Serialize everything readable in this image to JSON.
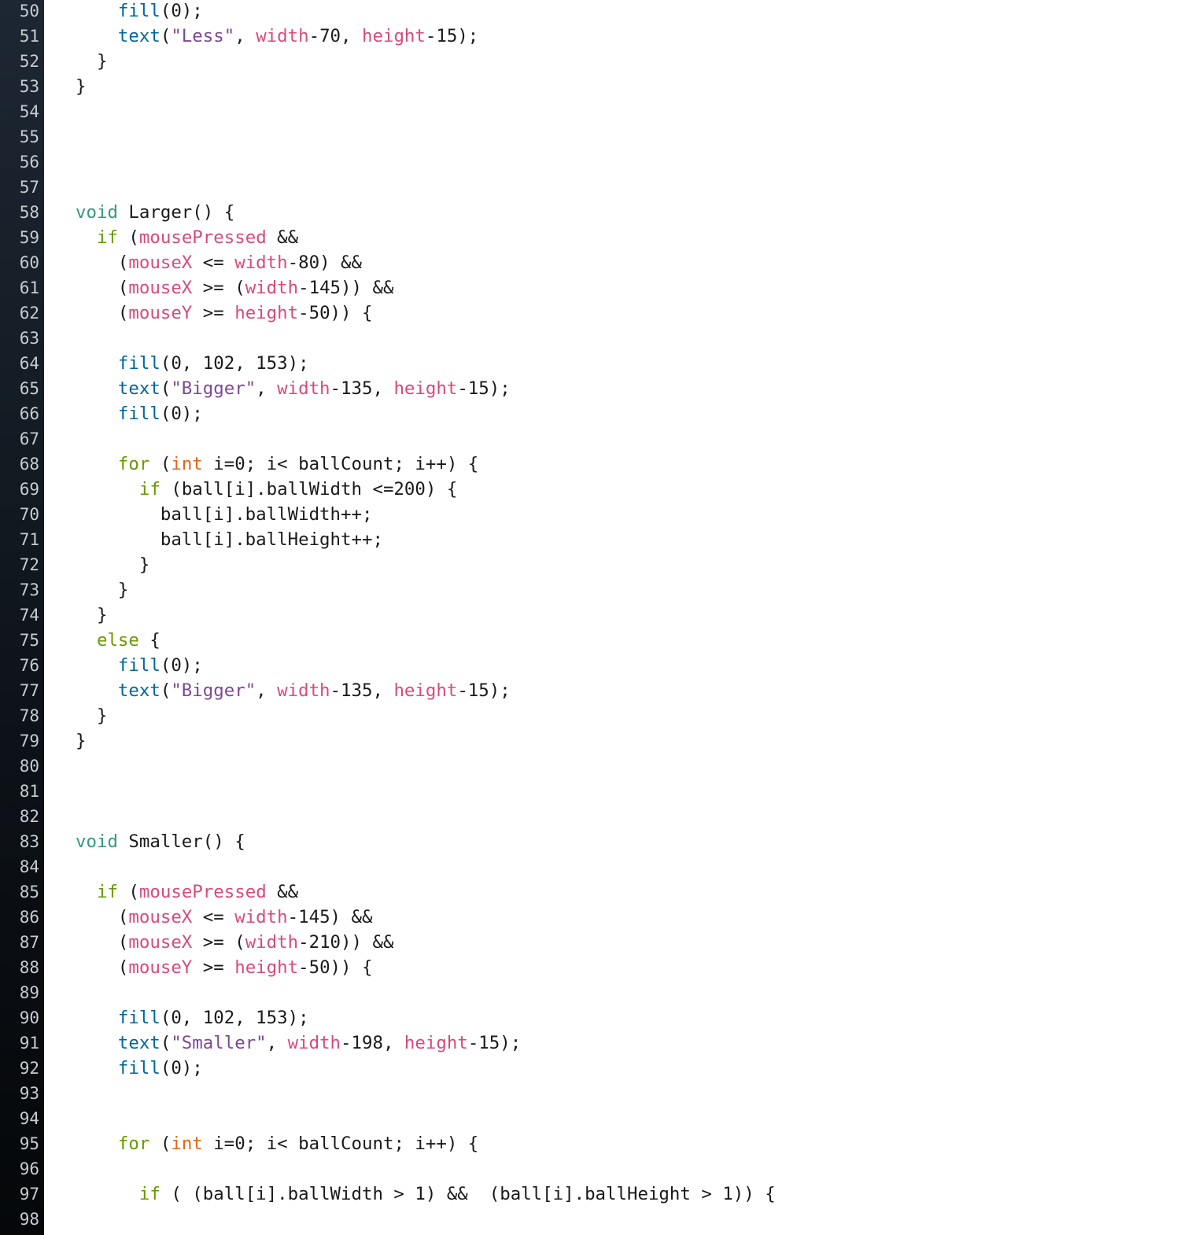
{
  "editor": {
    "language": "Processing",
    "colors": {
      "gutter_top": "#1d2733",
      "gutter_bottom": "#050709",
      "line_number": "#c7ccd2",
      "keyword_void": "#33997e",
      "keyword_control": "#669900",
      "function": "#006699",
      "builtin_variable": "#d94a7a",
      "string": "#7d4793",
      "type": "#e2661a",
      "plain": "#1a1a1a"
    },
    "lines": [
      {
        "n": "50",
        "tokens": [
          [
            "",
            "    "
          ],
          [
            "f",
            "fill"
          ],
          [
            "",
            "(0);"
          ]
        ]
      },
      {
        "n": "51",
        "tokens": [
          [
            "",
            "    "
          ],
          [
            "f",
            "text"
          ],
          [
            "",
            "("
          ],
          [
            "s",
            "\"Less\""
          ],
          [
            "",
            ", "
          ],
          [
            "v",
            "width"
          ],
          [
            "",
            "-70, "
          ],
          [
            "v",
            "height"
          ],
          [
            "",
            "-15);"
          ]
        ]
      },
      {
        "n": "52",
        "tokens": [
          [
            "",
            "  }"
          ]
        ]
      },
      {
        "n": "53",
        "tokens": [
          [
            "",
            "}"
          ]
        ]
      },
      {
        "n": "54",
        "tokens": []
      },
      {
        "n": "55",
        "tokens": []
      },
      {
        "n": "56",
        "tokens": []
      },
      {
        "n": "57",
        "tokens": []
      },
      {
        "n": "58",
        "tokens": [
          [
            "k",
            "void"
          ],
          [
            "",
            " Larger() {"
          ]
        ]
      },
      {
        "n": "59",
        "tokens": [
          [
            "",
            "  "
          ],
          [
            "kw",
            "if"
          ],
          [
            "",
            " ("
          ],
          [
            "v",
            "mousePressed"
          ],
          [
            "",
            " &&"
          ]
        ]
      },
      {
        "n": "60",
        "tokens": [
          [
            "",
            "    ("
          ],
          [
            "v",
            "mouseX"
          ],
          [
            "",
            " <= "
          ],
          [
            "v",
            "width"
          ],
          [
            "",
            "-80) &&"
          ]
        ]
      },
      {
        "n": "61",
        "tokens": [
          [
            "",
            "    ("
          ],
          [
            "v",
            "mouseX"
          ],
          [
            "",
            " >= ("
          ],
          [
            "v",
            "width"
          ],
          [
            "",
            "-145)) &&"
          ]
        ]
      },
      {
        "n": "62",
        "tokens": [
          [
            "",
            "    ("
          ],
          [
            "v",
            "mouseY"
          ],
          [
            "",
            " >= "
          ],
          [
            "v",
            "height"
          ],
          [
            "",
            "-50)) {"
          ]
        ]
      },
      {
        "n": "63",
        "tokens": []
      },
      {
        "n": "64",
        "tokens": [
          [
            "",
            "    "
          ],
          [
            "f",
            "fill"
          ],
          [
            "",
            "(0, 102, 153);"
          ]
        ]
      },
      {
        "n": "65",
        "tokens": [
          [
            "",
            "    "
          ],
          [
            "f",
            "text"
          ],
          [
            "",
            "("
          ],
          [
            "s",
            "\"Bigger\""
          ],
          [
            "",
            ", "
          ],
          [
            "v",
            "width"
          ],
          [
            "",
            "-135, "
          ],
          [
            "v",
            "height"
          ],
          [
            "",
            "-15);"
          ]
        ]
      },
      {
        "n": "66",
        "tokens": [
          [
            "",
            "    "
          ],
          [
            "f",
            "fill"
          ],
          [
            "",
            "(0);"
          ]
        ]
      },
      {
        "n": "67",
        "tokens": []
      },
      {
        "n": "68",
        "tokens": [
          [
            "",
            "    "
          ],
          [
            "kw",
            "for"
          ],
          [
            "",
            " ("
          ],
          [
            "t",
            "int"
          ],
          [
            "",
            " i=0; i< ballCount; i++) {"
          ]
        ]
      },
      {
        "n": "69",
        "tokens": [
          [
            "",
            "      "
          ],
          [
            "kw",
            "if"
          ],
          [
            "",
            " (ball[i].ballWidth <=200) {"
          ]
        ]
      },
      {
        "n": "70",
        "tokens": [
          [
            "",
            "        ball[i].ballWidth++;"
          ]
        ]
      },
      {
        "n": "71",
        "tokens": [
          [
            "",
            "        ball[i].ballHeight++;"
          ]
        ]
      },
      {
        "n": "72",
        "tokens": [
          [
            "",
            "      }"
          ]
        ]
      },
      {
        "n": "73",
        "tokens": [
          [
            "",
            "    }"
          ]
        ]
      },
      {
        "n": "74",
        "tokens": [
          [
            "",
            "  }"
          ]
        ]
      },
      {
        "n": "75",
        "tokens": [
          [
            "",
            "  "
          ],
          [
            "kw",
            "else"
          ],
          [
            "",
            " {"
          ]
        ]
      },
      {
        "n": "76",
        "tokens": [
          [
            "",
            "    "
          ],
          [
            "f",
            "fill"
          ],
          [
            "",
            "(0);"
          ]
        ]
      },
      {
        "n": "77",
        "tokens": [
          [
            "",
            "    "
          ],
          [
            "f",
            "text"
          ],
          [
            "",
            "("
          ],
          [
            "s",
            "\"Bigger\""
          ],
          [
            "",
            ", "
          ],
          [
            "v",
            "width"
          ],
          [
            "",
            "-135, "
          ],
          [
            "v",
            "height"
          ],
          [
            "",
            "-15);"
          ]
        ]
      },
      {
        "n": "78",
        "tokens": [
          [
            "",
            "  }"
          ]
        ]
      },
      {
        "n": "79",
        "tokens": [
          [
            "",
            "}"
          ]
        ]
      },
      {
        "n": "80",
        "tokens": []
      },
      {
        "n": "81",
        "tokens": []
      },
      {
        "n": "82",
        "tokens": []
      },
      {
        "n": "83",
        "tokens": [
          [
            "k",
            "void"
          ],
          [
            "",
            " Smaller() {"
          ]
        ]
      },
      {
        "n": "84",
        "tokens": []
      },
      {
        "n": "85",
        "tokens": [
          [
            "",
            "  "
          ],
          [
            "kw",
            "if"
          ],
          [
            "",
            " ("
          ],
          [
            "v",
            "mousePressed"
          ],
          [
            "",
            " &&"
          ]
        ]
      },
      {
        "n": "86",
        "tokens": [
          [
            "",
            "    ("
          ],
          [
            "v",
            "mouseX"
          ],
          [
            "",
            " <= "
          ],
          [
            "v",
            "width"
          ],
          [
            "",
            "-145) &&"
          ]
        ]
      },
      {
        "n": "87",
        "tokens": [
          [
            "",
            "    ("
          ],
          [
            "v",
            "mouseX"
          ],
          [
            "",
            " >= ("
          ],
          [
            "v",
            "width"
          ],
          [
            "",
            "-210)) &&"
          ]
        ]
      },
      {
        "n": "88",
        "tokens": [
          [
            "",
            "    ("
          ],
          [
            "v",
            "mouseY"
          ],
          [
            "",
            " >= "
          ],
          [
            "v",
            "height"
          ],
          [
            "",
            "-50)) {"
          ]
        ]
      },
      {
        "n": "89",
        "tokens": []
      },
      {
        "n": "90",
        "tokens": [
          [
            "",
            "    "
          ],
          [
            "f",
            "fill"
          ],
          [
            "",
            "(0, 102, 153);"
          ]
        ]
      },
      {
        "n": "91",
        "tokens": [
          [
            "",
            "    "
          ],
          [
            "f",
            "text"
          ],
          [
            "",
            "("
          ],
          [
            "s",
            "\"Smaller\""
          ],
          [
            "",
            ", "
          ],
          [
            "v",
            "width"
          ],
          [
            "",
            "-198, "
          ],
          [
            "v",
            "height"
          ],
          [
            "",
            "-15);"
          ]
        ]
      },
      {
        "n": "92",
        "tokens": [
          [
            "",
            "    "
          ],
          [
            "f",
            "fill"
          ],
          [
            "",
            "(0);"
          ]
        ]
      },
      {
        "n": "93",
        "tokens": []
      },
      {
        "n": "94",
        "tokens": []
      },
      {
        "n": "95",
        "tokens": [
          [
            "",
            "    "
          ],
          [
            "kw",
            "for"
          ],
          [
            "",
            " ("
          ],
          [
            "t",
            "int"
          ],
          [
            "",
            " i=0; i< ballCount; i++) {"
          ]
        ]
      },
      {
        "n": "96",
        "tokens": []
      },
      {
        "n": "97",
        "tokens": [
          [
            "",
            "      "
          ],
          [
            "kw",
            "if"
          ],
          [
            "",
            " ( (ball[i].ballWidth > 1) &&  (ball[i].ballHeight > 1)) {"
          ]
        ]
      },
      {
        "n": "98",
        "tokens": []
      }
    ]
  }
}
